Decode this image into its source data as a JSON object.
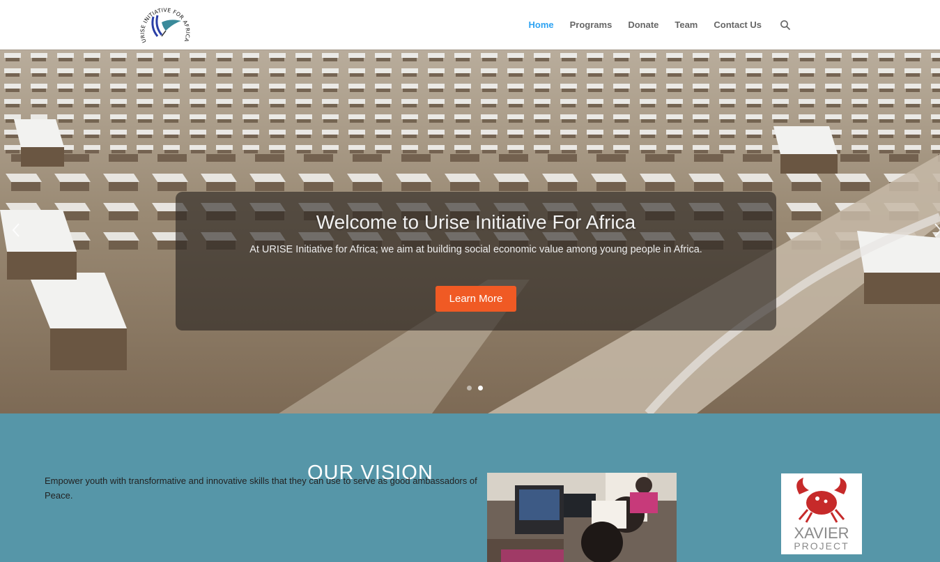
{
  "header": {
    "logo_text": "URISE INITIATIVE FOR AFRICA",
    "nav": [
      {
        "label": "Home",
        "active": true
      },
      {
        "label": "Programs",
        "active": false
      },
      {
        "label": "Donate",
        "active": false
      },
      {
        "label": "Team",
        "active": false
      },
      {
        "label": "Contact Us",
        "active": false
      }
    ]
  },
  "hero": {
    "title": "Welcome to Urise Initiative For Africa",
    "description": "At URISE Initiative for Africa; we aim at building social economic value among young people in Africa.",
    "button_label": "Learn More",
    "slide_count": 2,
    "active_slide": 2
  },
  "vision": {
    "heading": "OUR VISION",
    "text": "Empower youth with transformative and innovative skills that they can use to serve as good ambassadors of Peace."
  },
  "partner": {
    "name_line1": "XAVIER",
    "name_line2": "PROJECT"
  },
  "colors": {
    "accent": "#2ea3f2",
    "button": "#f05a24",
    "vision_bg": "#5696a8"
  }
}
